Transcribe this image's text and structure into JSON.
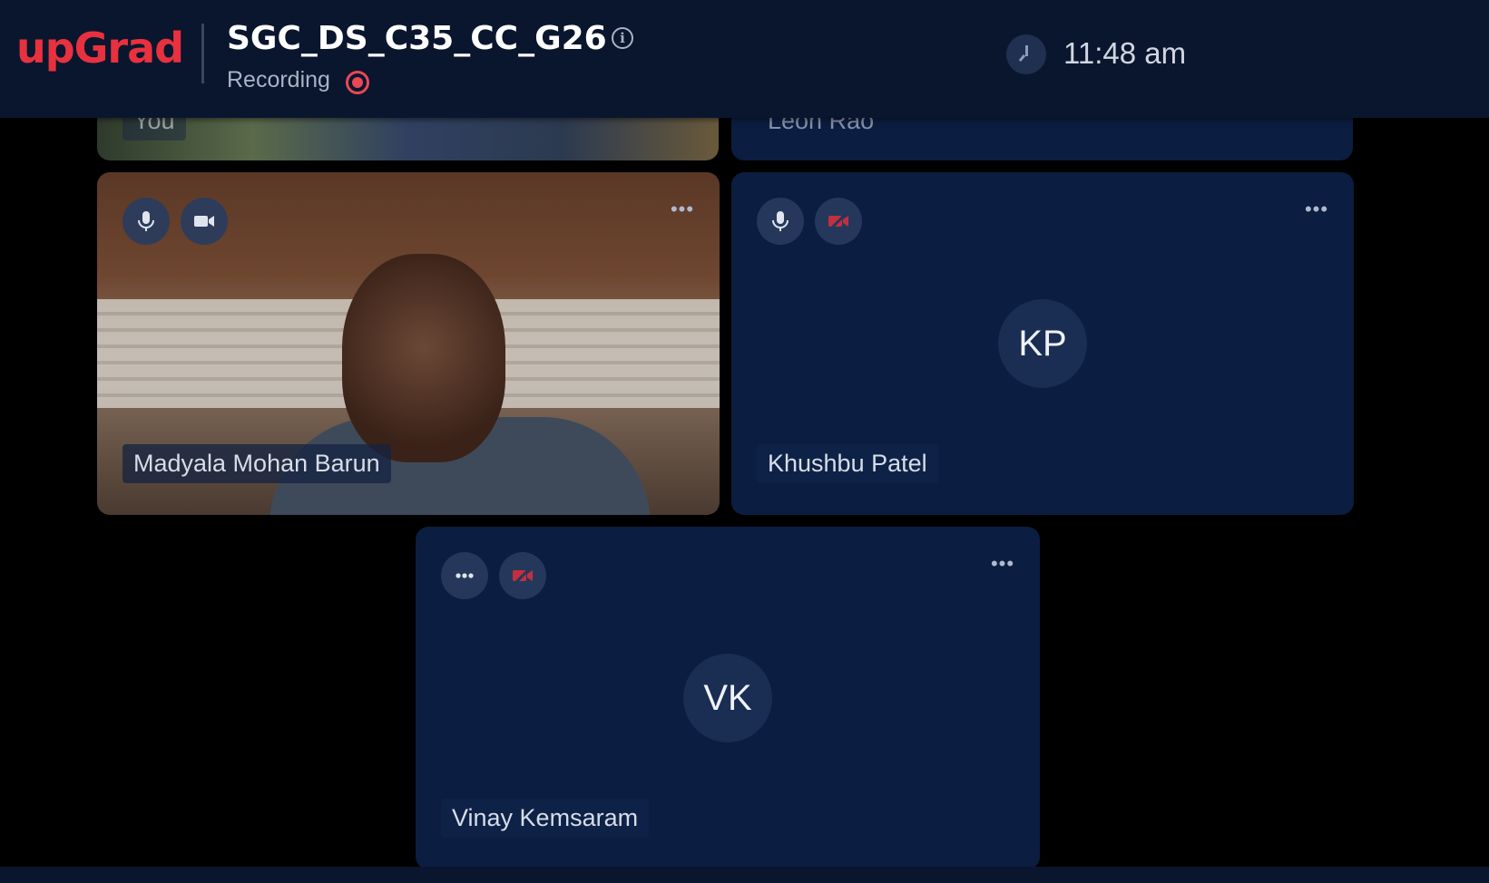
{
  "header": {
    "logo": "upGrad",
    "title": "SGC_DS_C35_CC_G26",
    "recording_label": "Recording",
    "time": "11:48 am"
  },
  "tiles": {
    "top_left": {
      "name": "You"
    },
    "top_right": {
      "name": "Leon Rao"
    },
    "madyala": {
      "name": "Madyala Mohan Barun"
    },
    "khushbu": {
      "name": "Khushbu Patel",
      "initials": "KP"
    },
    "vinay": {
      "name": "Vinay Kemsaram",
      "initials": "VK"
    }
  },
  "colors": {
    "brand": "#e8313f",
    "recording": "#e94854",
    "tile_bg": "#0b1d40",
    "header_bg": "#0a162e",
    "video_off": "#c0303f"
  },
  "icons": {
    "mic": "mic-icon",
    "camera": "camera-icon",
    "camera_off": "camera-off-icon",
    "more": "more-options-icon",
    "clock": "clock-icon",
    "info": "info-icon"
  }
}
